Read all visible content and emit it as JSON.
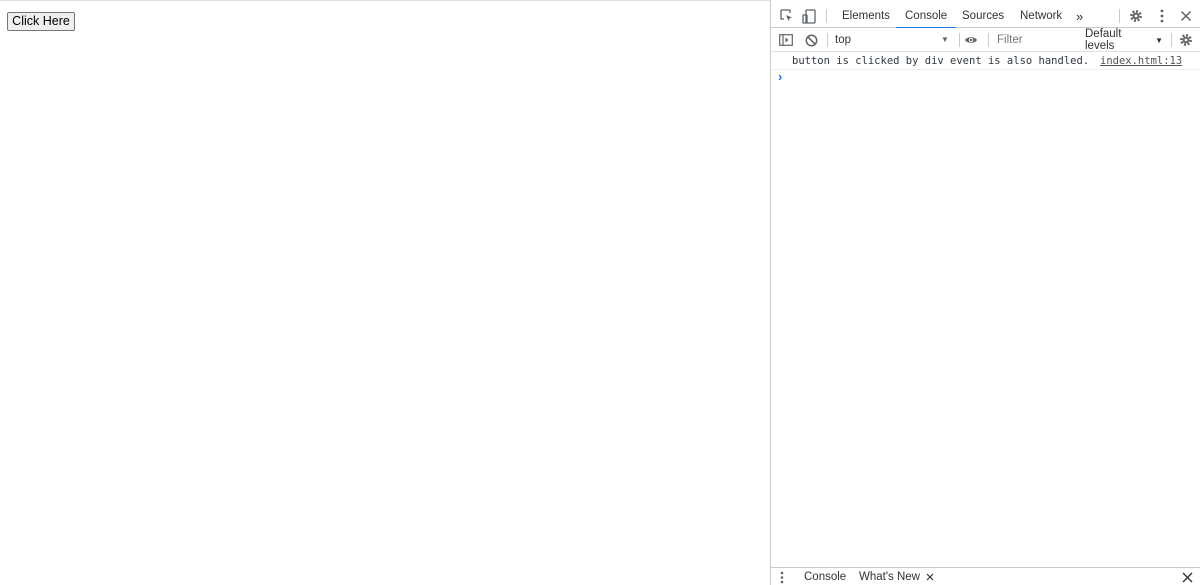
{
  "page": {
    "button_label": "Click Here"
  },
  "devtools": {
    "tabs": [
      {
        "label": "Elements"
      },
      {
        "label": "Console",
        "active": true
      },
      {
        "label": "Sources"
      },
      {
        "label": "Network"
      }
    ],
    "more_tabs_glyph": "»",
    "toolbar": {
      "context": "top",
      "filter_placeholder": "Filter",
      "levels_label": "Default levels"
    },
    "console": {
      "messages": [
        {
          "text": "button is clicked by div event is also handled.",
          "source": "index.html:13"
        }
      ],
      "prompt_glyph": "›"
    },
    "drawer": {
      "tabs": [
        {
          "label": "Console"
        },
        {
          "label": "What's New"
        }
      ]
    },
    "colors": {
      "accent": "#1a73e8",
      "icon": "#5f6368"
    }
  }
}
